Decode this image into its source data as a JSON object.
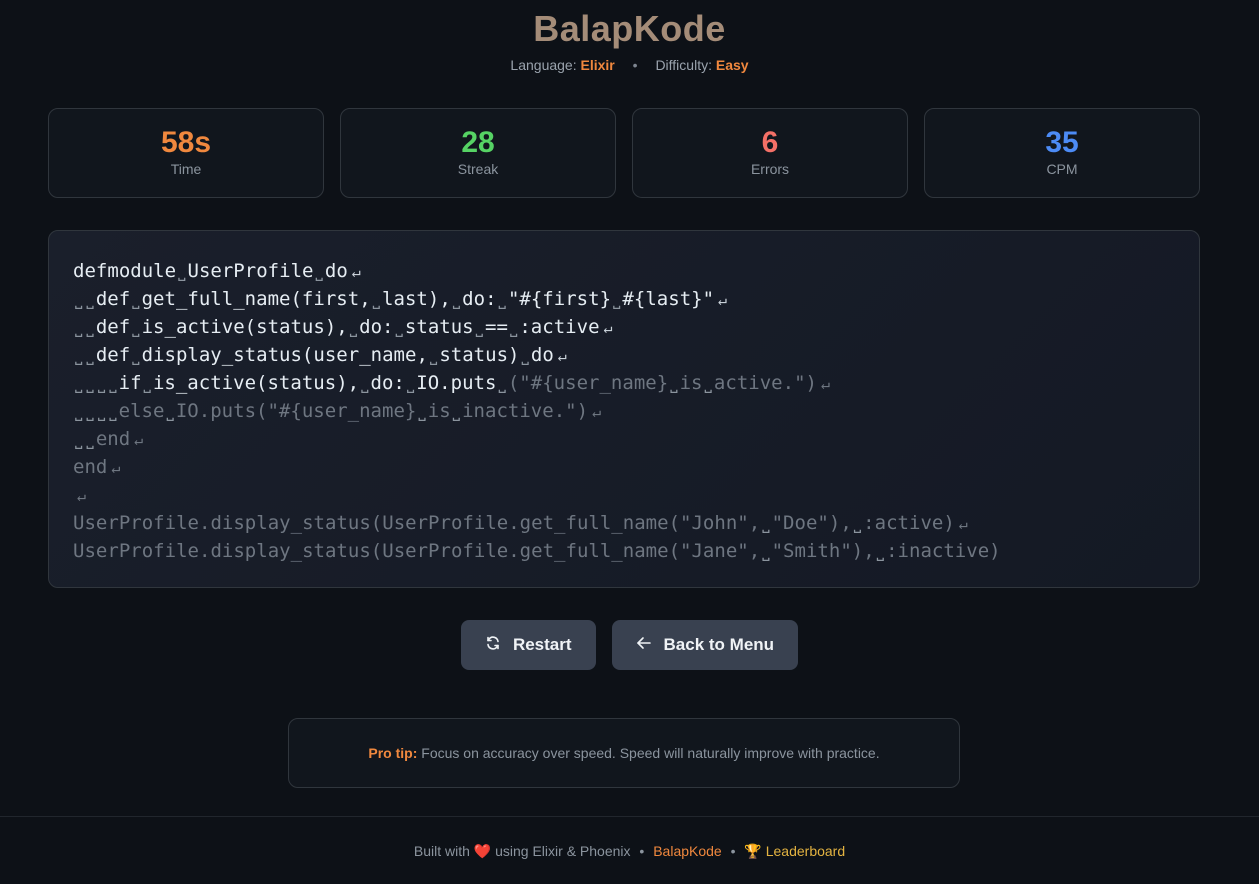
{
  "header": {
    "title": "BalapKode",
    "language_label": "Language:",
    "language_value": "Elixir",
    "difficulty_label": "Difficulty:",
    "difficulty_value": "Easy"
  },
  "stats": [
    {
      "value": "58s",
      "label": "Time",
      "color": "#f0883e"
    },
    {
      "value": "28",
      "label": "Streak",
      "color": "#56d364"
    },
    {
      "value": "6",
      "label": "Errors",
      "color": "#f47067"
    },
    {
      "value": "35",
      "label": "CPM",
      "color": "#4c8bf5"
    }
  ],
  "code": {
    "space_glyph": "˽",
    "newline_glyph": "↵",
    "lines": [
      {
        "typed": "defmodule UserProfile do",
        "pending": "",
        "newline": true
      },
      {
        "typed": "  def get_full_name(first, last), do: \"#{first} #{last}\"",
        "pending": "",
        "newline": true
      },
      {
        "typed": "  def is_active(status), do: status == :active",
        "pending": "",
        "newline": true
      },
      {
        "typed": "  def display_status(user_name, status) do",
        "pending": "",
        "newline": true
      },
      {
        "typed": "    if is_active(status), do: IO.puts",
        "pending": " (\"#{user_name} is active.\")",
        "newline": true
      },
      {
        "typed": "",
        "pending": "    else IO.puts(\"#{user_name} is inactive.\")",
        "newline": true
      },
      {
        "typed": "",
        "pending": "  end",
        "newline": true
      },
      {
        "typed": "",
        "pending": "end",
        "newline": true
      },
      {
        "typed": "",
        "pending": "",
        "newline": true
      },
      {
        "typed": "",
        "pending": "UserProfile.display_status(UserProfile.get_full_name(\"John\", \"Doe\"), :active)",
        "newline": true
      },
      {
        "typed": "",
        "pending": "UserProfile.display_status(UserProfile.get_full_name(\"Jane\", \"Smith\"), :inactive)",
        "newline": false
      }
    ]
  },
  "buttons": {
    "restart_label": "Restart",
    "restart_icon": "refresh-icon",
    "back_label": "Back to Menu",
    "back_icon": "arrow-left-icon"
  },
  "tip": {
    "label": "Pro tip:",
    "text": " Focus on accuracy over speed. Speed will naturally improve with practice."
  },
  "footer": {
    "built_with": "Built with",
    "using": "using Elixir & Phoenix",
    "separator": "•",
    "brand_link": "BalapKode",
    "leaderboard_link": "Leaderboard",
    "leaderboard_icon": "trophy-icon"
  }
}
